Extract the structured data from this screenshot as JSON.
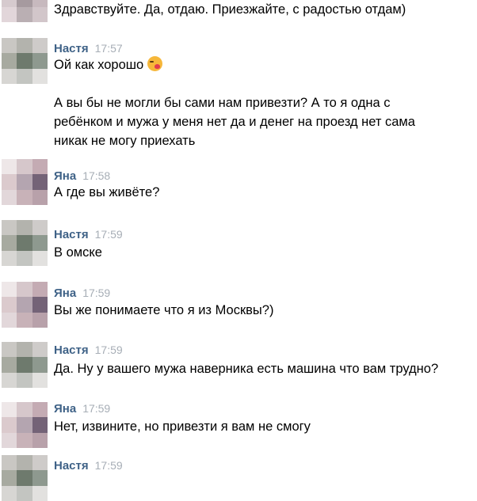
{
  "messages": [
    {
      "author": "",
      "time": "",
      "lines": [
        "Здравствуйте. Да, отдаю. Приезжайте, с радостью отдам)"
      ],
      "avatar": [
        "#b6a7ad",
        "#7d6f76",
        "#c7b6bb",
        "#d8c9ce",
        "#a8999f",
        "#c9b8be",
        "#e3d6da",
        "#bcaeb3",
        "#d4c5ca"
      ]
    },
    {
      "author": "Настя",
      "time": "17:57",
      "lines": [
        "Ой как хорошо",
        "",
        "А вы бы не могли бы сами нам привезти? А то я одна с",
        "ребёнком и мужа у меня нет да и денег на проезд нет сама",
        "никак не могу приехать"
      ],
      "emoji": "kissing-heart-emoji",
      "avatar": [
        "#c9c7c2",
        "#b3b3ac",
        "#cfcbc8",
        "#a7aa9f",
        "#6d7b6b",
        "#8d9a8e",
        "#d7d6d3",
        "#c3c5c1",
        "#e2e1df"
      ]
    },
    {
      "author": "Яна",
      "time": "17:58",
      "lines": [
        "А где вы живёте?"
      ],
      "avatar": [
        "#efe7e8",
        "#d8c6cb",
        "#c7aab3",
        "#ddc9cd",
        "#b6a4b1",
        "#76627a",
        "#e4d7da",
        "#cbb1b8",
        "#bba0ab"
      ]
    },
    {
      "author": "Настя",
      "time": "17:59",
      "lines": [
        "В омске"
      ],
      "avatar": [
        "#c9c7c2",
        "#b3b3ac",
        "#cfcbc8",
        "#a7aa9f",
        "#6d7b6b",
        "#8d9a8e",
        "#d7d6d3",
        "#c3c5c1",
        "#e2e1df"
      ]
    },
    {
      "author": "Яна",
      "time": "17:59",
      "lines": [
        "Вы же понимаете что я из Москвы?)"
      ],
      "avatar": [
        "#efe7e8",
        "#d8c6cb",
        "#c7aab3",
        "#ddc9cd",
        "#b6a4b1",
        "#76627a",
        "#e4d7da",
        "#cbb1b8",
        "#bba0ab"
      ]
    },
    {
      "author": "Настя",
      "time": "17:59",
      "lines": [
        "Да. Ну у вашего мужа наверника есть машина что вам трудно?"
      ],
      "avatar": [
        "#c9c7c2",
        "#b3b3ac",
        "#cfcbc8",
        "#a7aa9f",
        "#6d7b6b",
        "#8d9a8e",
        "#d7d6d3",
        "#c3c5c1",
        "#e2e1df"
      ]
    },
    {
      "author": "Яна",
      "time": "17:59",
      "lines": [
        "Нет, извините, но привезти я вам не смогу"
      ],
      "avatar": [
        "#efe7e8",
        "#d8c6cb",
        "#c7aab3",
        "#ddc9cd",
        "#b6a4b1",
        "#76627a",
        "#e4d7da",
        "#cbb1b8",
        "#bba0ab"
      ]
    },
    {
      "author": "Настя",
      "time": "17:59",
      "lines": [],
      "avatar": [
        "#c9c7c2",
        "#b3b3ac",
        "#cfcbc8",
        "#a7aa9f",
        "#6d7b6b",
        "#8d9a8e",
        "#d7d6d3",
        "#c3c5c1",
        "#e2e1df"
      ]
    }
  ],
  "colors": {
    "author": "#3f6287",
    "time": "#a7aeb6",
    "text": "#000000",
    "background": "#ffffff"
  }
}
